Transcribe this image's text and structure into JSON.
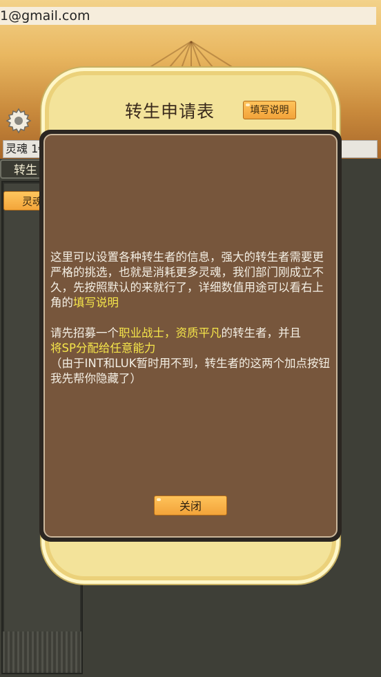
{
  "account": {
    "email": "1@gmail.com"
  },
  "hud": {
    "soul_label": "灵魂 1€",
    "soul_value": ""
  },
  "tabs": {
    "rebirth_label": "转生"
  },
  "left_panel": {
    "soul_button_label": "灵魂"
  },
  "modal": {
    "title": "转生申请表",
    "help_button_label": "填写说明",
    "paragraph1": "这里可以设置各种转生者的信息，强大的转生者需要更严格的挑选，也就是消耗更多灵魂，我们部门刚成立不久，先按照默认的来就行了，详细数值用途可以看右上角的",
    "paragraph1_highlight": "填写说明",
    "paragraph2_a": "请先招募一个",
    "paragraph2_highlight1": "职业战士，资质平凡",
    "paragraph2_b": "的转生者，并且",
    "paragraph2_highlight2": "将SP分配给任意能力",
    "paragraph3": "（由于INT和LUK暂时用不到，转生者的这两个加点按钮我先帮你隐藏了）",
    "close_button_label": "关闭"
  },
  "colors": {
    "highlight": "#f6e64a",
    "button": "#f2a33a",
    "paper": "#77563c",
    "frame": "#f3e39a"
  },
  "icons": {
    "settings": "gear-icon"
  }
}
